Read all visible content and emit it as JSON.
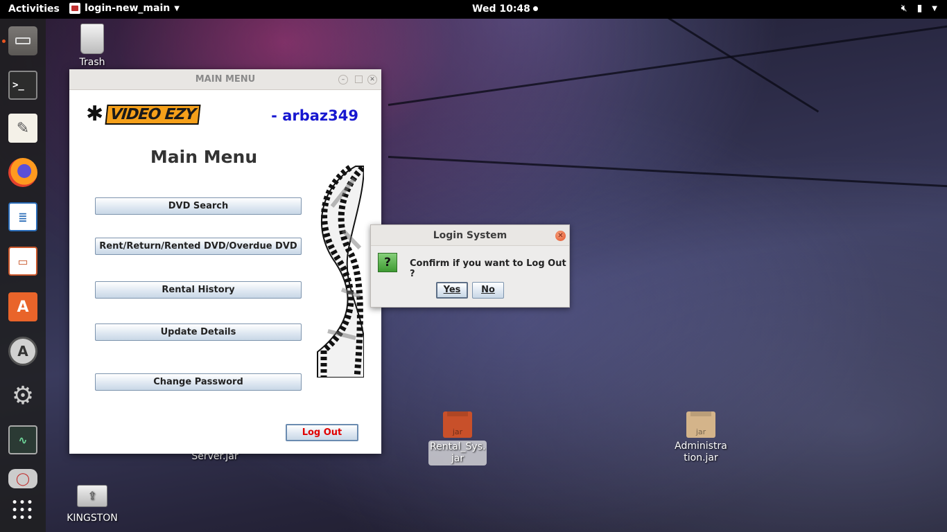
{
  "topbar": {
    "activities": "Activities",
    "app_name": "login-new_main",
    "clock": "Wed 10:48"
  },
  "dock": {
    "items": [
      "files",
      "terminal",
      "text-editor",
      "firefox",
      "libreoffice-writer",
      "libreoffice-impress",
      "ubuntu-software",
      "software-updater",
      "system-settings",
      "system-monitor",
      "disk",
      "show-applications"
    ]
  },
  "desktop": {
    "trash_label": "Trash",
    "server_label": "Server.jar",
    "rental_label_1": "Rental_Sys.",
    "rental_label_2": "jar",
    "jar_text": "jar",
    "admin_label_1": "Administra",
    "admin_label_2": "tion.jar",
    "usb_label": "KINGSTON"
  },
  "main_window": {
    "title": "MAIN MENU",
    "logo_text": "VIDEO EZY",
    "user": "- arbaz349",
    "heading": "Main Menu",
    "buttons": {
      "dvd_search": "DVD Search",
      "rent_return": "Rent/Return/Rented DVD/Overdue DVD",
      "rental_history": "Rental History",
      "update_details": "Update Details",
      "change_password": "Change Password"
    },
    "logout": "Log Out"
  },
  "dialog": {
    "title": "Login System",
    "icon": "?",
    "message": "Confirm if you want to Log Out ?",
    "yes": "Yes",
    "no": "No"
  },
  "colors": {
    "accent_user": "#1717d0",
    "logout_text": "#e00000",
    "ubuntu_orange": "#e95420"
  }
}
